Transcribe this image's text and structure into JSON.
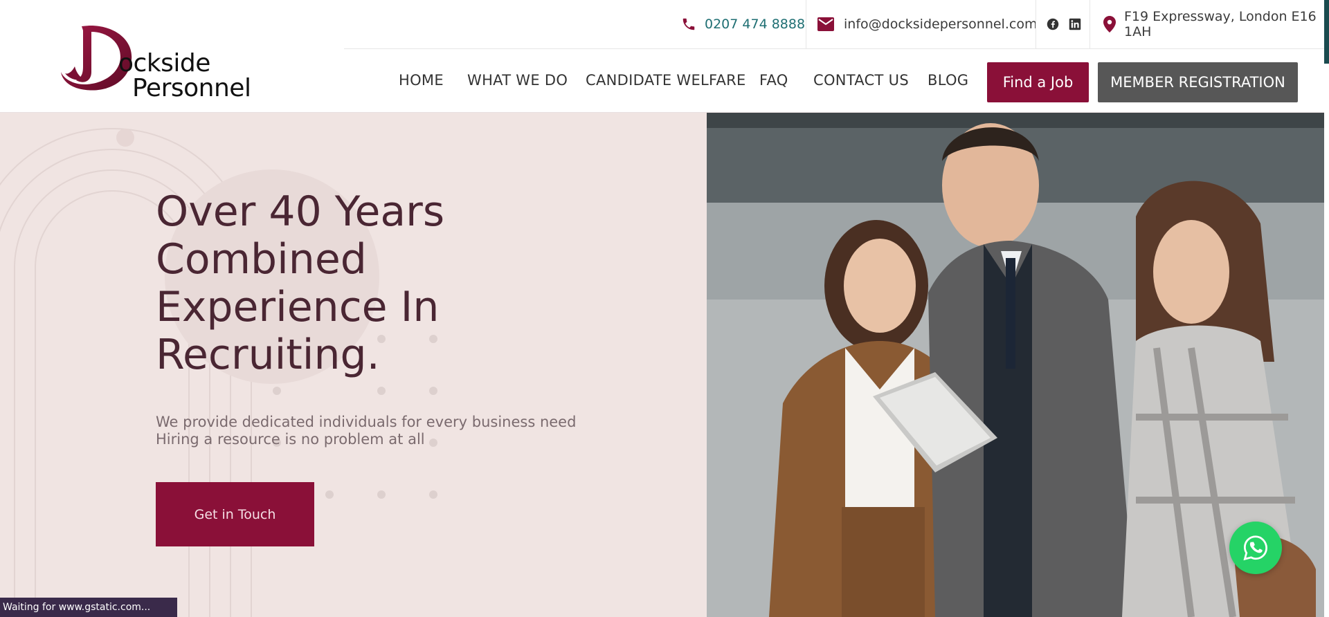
{
  "topbar": {
    "phone": "0207 474 8888",
    "email": "info@docksidepersonnel.com",
    "social": [
      "facebook-icon",
      "linkedin-icon"
    ],
    "address": "F19 Expressway, London E16 1AH"
  },
  "logo": {
    "line1": "ockside",
    "line2": "Personnel"
  },
  "nav": {
    "items": [
      "HOME",
      "WHAT WE DO",
      "CANDIDATE WELFARE",
      "FAQ",
      "CONTACT US",
      "BLOG"
    ],
    "find_job": "Find a Job",
    "member_registration": "MEMBER REGISTRATION"
  },
  "hero": {
    "title_lines": [
      "Over 40 Years",
      "Combined",
      "Experience In",
      "Recruiting."
    ],
    "subtitle_lines": [
      "We provide dedicated individuals for every business need",
      "Hiring a resource is no problem at all"
    ],
    "cta": "Get in Touch"
  },
  "status": "Waiting for www.gstatic.com...",
  "colors": {
    "brand": "#8a1038",
    "teal": "#1f6f73",
    "hero_bg": "#f0e4e2",
    "member_btn": "#575757",
    "whatsapp": "#25d366"
  }
}
